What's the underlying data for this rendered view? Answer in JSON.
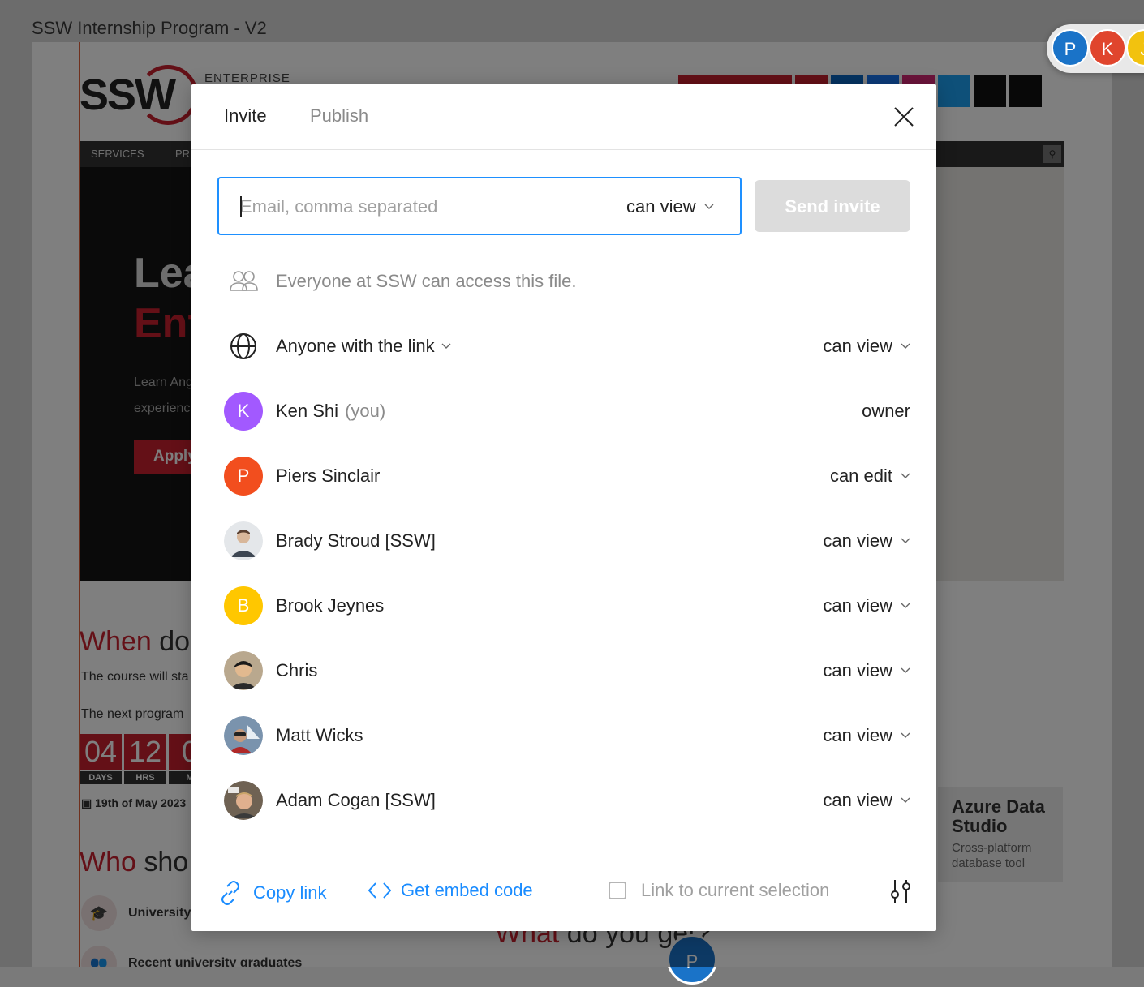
{
  "background": {
    "frame_title": "SSW Internship Program - V2",
    "enterprise_label": "ENTERPRISE",
    "nav_items": [
      "SERVICES",
      "PR"
    ],
    "hero_title_line1": "Lea",
    "hero_title_line2": "Ent",
    "hero_lead_line1": "Learn Ang",
    "hero_lead_line2": "experienc",
    "hero_button": "Apply",
    "when_heading_red": "When",
    "when_heading_rest": " do",
    "course_text": "The course will sta",
    "next_program_text": "The next program",
    "countdown": [
      {
        "value": "04",
        "label": "DAYS"
      },
      {
        "value": "12",
        "label": "HRS"
      },
      {
        "value": "0",
        "label": "M"
      }
    ],
    "date_text": "19th of May 2023",
    "who_heading_red": "Who",
    "who_heading_rest": " sho",
    "who_items": [
      "University",
      "Recent university graduates"
    ],
    "azure_title": "Azure Data Studio",
    "azure_sub": "Cross-platform database tool",
    "what_red": "What",
    "what_rest": " do you get?",
    "bottom_avatar_letter": "P"
  },
  "presence": [
    {
      "letter": "P",
      "color": "#1a73c8"
    },
    {
      "letter": "K",
      "color": "#e0452d"
    },
    {
      "letter": "J",
      "color": "#f2c20f"
    }
  ],
  "modal": {
    "tabs": {
      "invite": "Invite",
      "publish": "Publish"
    },
    "invite": {
      "placeholder": "Email, comma separated",
      "permission": "can view",
      "send_label": "Send invite"
    },
    "org_access": "Everyone at SSW can access this file.",
    "link_access": {
      "label": "Anyone with the link",
      "permission": "can view"
    },
    "members": [
      {
        "name": "Ken Shi",
        "suffix": "(you)",
        "permission": "owner",
        "avatar": "K",
        "color": "#a259ff"
      },
      {
        "name": "Piers Sinclair",
        "suffix": "",
        "permission": "can edit",
        "avatar": "P",
        "color": "#f24e1e"
      },
      {
        "name": "Brady Stroud [SSW]",
        "suffix": "",
        "permission": "can view",
        "avatar": "photo",
        "color": "#cfd6dc"
      },
      {
        "name": "Brook Jeynes",
        "suffix": "",
        "permission": "can view",
        "avatar": "B",
        "color": "#ffc700"
      },
      {
        "name": "Chris",
        "suffix": "",
        "permission": "can view",
        "avatar": "photo",
        "color": "#c9b49a"
      },
      {
        "name": "Matt Wicks",
        "suffix": "",
        "permission": "can view",
        "avatar": "photo",
        "color": "#5b6f86"
      },
      {
        "name": "Adam Cogan [SSW]",
        "suffix": "",
        "permission": "can view",
        "avatar": "photo",
        "color": "#8c7a6a"
      }
    ],
    "footer": {
      "copy_link": "Copy link",
      "embed": "Get embed code",
      "link_selection": "Link to current selection"
    }
  }
}
